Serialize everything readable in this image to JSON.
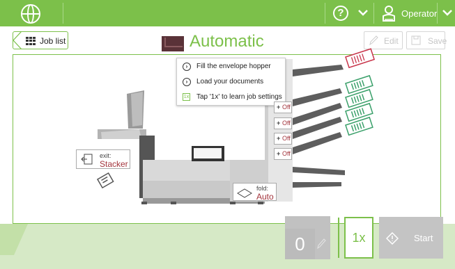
{
  "topbar": {
    "globe_icon": "globe-icon",
    "help_icon": "help-icon",
    "user_label": "Operator",
    "accent": "#7cc04a"
  },
  "header": {
    "back_label": "Job list",
    "title": "Automatic",
    "edit_label": "Edit",
    "save_label": "Save"
  },
  "instructions": [
    {
      "icon": "chevron-right-icon",
      "text": "Fill the envelope hopper"
    },
    {
      "icon": "chevron-right-icon",
      "text": "Load your documents"
    },
    {
      "icon": "one-x-icon",
      "badge": "1x",
      "text": "Tap '1x' to learn job settings"
    }
  ],
  "feeders": [
    {
      "state": "Off"
    },
    {
      "state": "Off"
    },
    {
      "state": "Off"
    },
    {
      "state": "Off"
    }
  ],
  "exit": {
    "key": "exit:",
    "value": "Stacker"
  },
  "fold": {
    "key": "fold:",
    "value": "Auto"
  },
  "footer": {
    "count": "0",
    "one_x": "1x",
    "start_label": "Start"
  }
}
